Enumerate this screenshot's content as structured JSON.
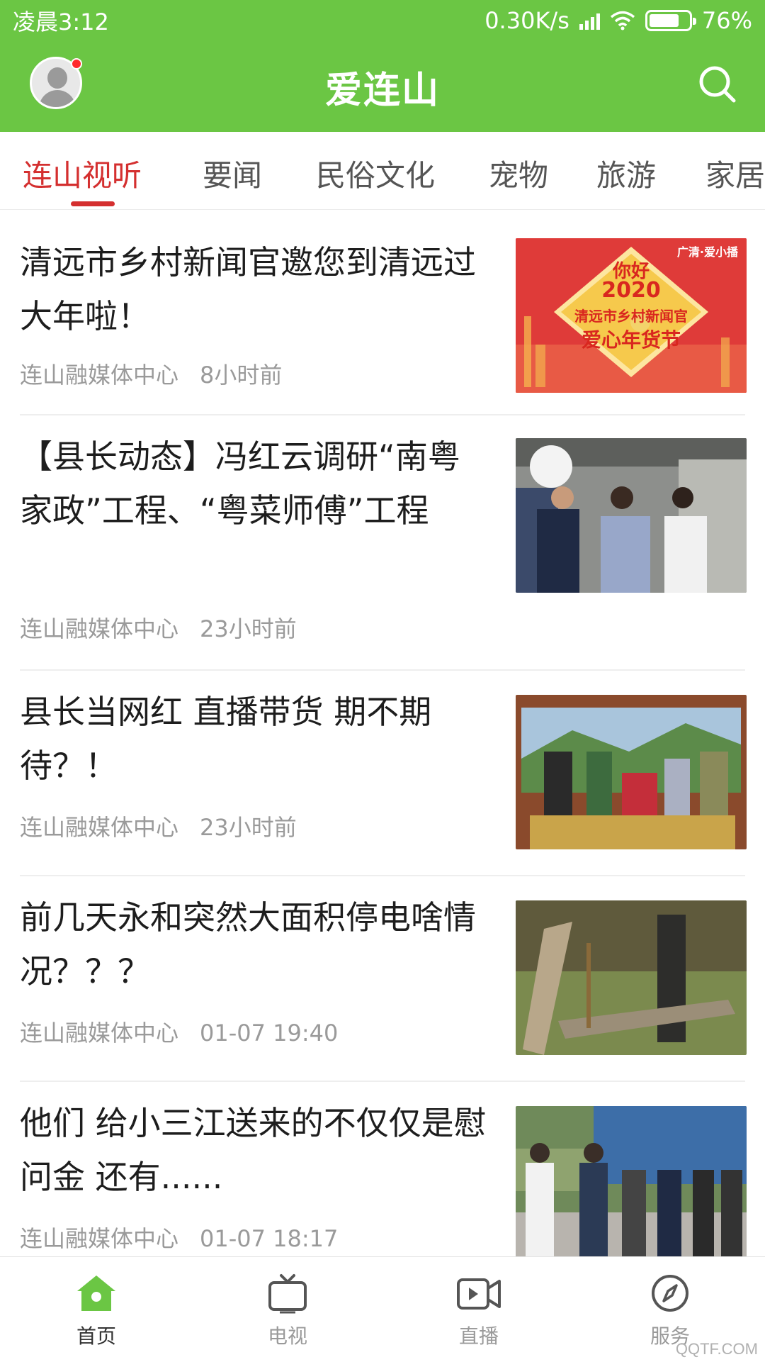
{
  "status_bar": {
    "time": "凌晨3:12",
    "net_speed": "0.30K/s",
    "battery_percent_text": "76%",
    "battery_level": 0.76
  },
  "header": {
    "title": "爱连山",
    "brand_color": "#6bc644"
  },
  "tabs": [
    {
      "label": "连山视听",
      "active": true
    },
    {
      "label": "要闻",
      "active": false
    },
    {
      "label": "民俗文化",
      "active": false
    },
    {
      "label": "宠物",
      "active": false
    },
    {
      "label": "旅游",
      "active": false
    },
    {
      "label": "家居",
      "active": false
    }
  ],
  "feed": [
    {
      "title": "清远市乡村新闻官邀您到清远过大年啦！",
      "source": "连山融媒体中心",
      "time": "8小时前",
      "thumb": {
        "banner_text_1": "你好",
        "banner_text_2": "2020",
        "banner_text_3": "清远市乡村新闻官",
        "banner_text_4": "爱心年货节",
        "corner_text": "广清·爱小播"
      }
    },
    {
      "title": "【县长动态】冯红云调研“南粤家政”工程、“粤菜师傅”工程",
      "source": "连山融媒体中心",
      "time": "23小时前"
    },
    {
      "title": "县长当网红 直播带货 期不期待？！",
      "source": "连山融媒体中心",
      "time": "23小时前"
    },
    {
      "title": "前几天永和突然大面积停电啥情况？？？",
      "source": "连山融媒体中心",
      "time": "01-07 19:40"
    },
    {
      "title": "他们 给小三江送来的不仅仅是慰问金 还有......",
      "source": "连山融媒体中心",
      "time": "01-07 18:17"
    }
  ],
  "bottom_nav": [
    {
      "label": "首页",
      "icon": "home-icon",
      "active": true
    },
    {
      "label": "电视",
      "icon": "tv-icon",
      "active": false
    },
    {
      "label": "直播",
      "icon": "live-video-icon",
      "active": false
    },
    {
      "label": "服务",
      "icon": "compass-icon",
      "active": false
    }
  ],
  "watermark": "QQTF.COM",
  "colors": {
    "accent_red": "#d42f2f",
    "nav_active_green": "#6bc644"
  }
}
